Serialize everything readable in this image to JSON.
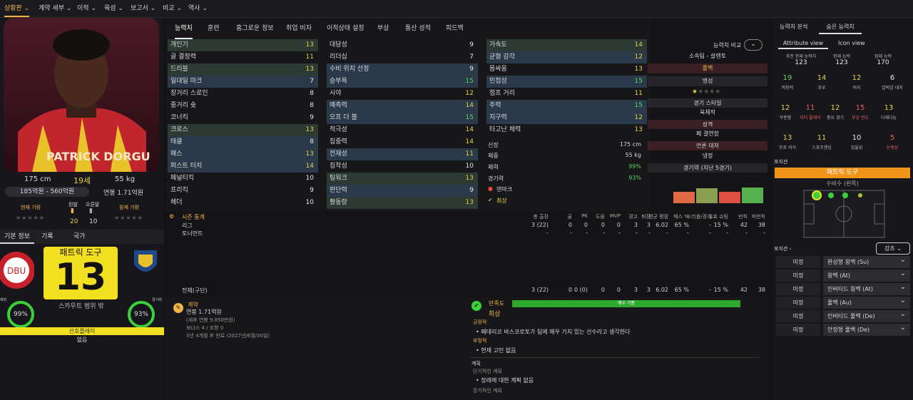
{
  "menu": [
    "상황판",
    "계약 세부",
    "이적",
    "육성",
    "보고서",
    "비교",
    "역사"
  ],
  "player": {
    "name": "PATRICK DORGU",
    "name_kr": "패트릭 도구",
    "number": "13",
    "height": "175 cm",
    "age": "19세",
    "weight": "55 kg",
    "value": "185억원 - 560억원",
    "wage": "연봉 1.71억원",
    "current_form": "현재 기량",
    "potential": "잠재 기량",
    "left_foot_label": "왼발",
    "right_foot_label": "오른발",
    "left_foot": "20",
    "right_foot": "10",
    "scout": "스카우트 범위 밖",
    "role_label": "선호플레이",
    "role_value": "없음",
    "pct_left": "99%",
    "pct_right": "93%",
    "pct_left_label": "체력",
    "pct_right_label": "경기력"
  },
  "left_tabs": [
    "기본 정보",
    "기록",
    "국가"
  ],
  "tabs": [
    "능력치",
    "훈련",
    "홈그로운 정보",
    "취업 비자",
    "이적상태 설정",
    "부상",
    "통산 성적",
    "피드백"
  ],
  "attributes_col1": [
    {
      "n": "개인기",
      "v": "13"
    },
    {
      "n": "골 결정력",
      "v": "11"
    },
    {
      "n": "드리블",
      "v": "13"
    },
    {
      "n": "일대일 마크",
      "v": "7"
    },
    {
      "n": "장거리 스로인",
      "v": "8"
    },
    {
      "n": "중거리 슛",
      "v": "8"
    },
    {
      "n": "코너킥",
      "v": "9"
    },
    {
      "n": "크로스",
      "v": "13"
    },
    {
      "n": "태클",
      "v": "8"
    },
    {
      "n": "패스",
      "v": "13"
    },
    {
      "n": "퍼스트 터치",
      "v": "14"
    },
    {
      "n": "페널티킥",
      "v": "10"
    },
    {
      "n": "프리킥",
      "v": "9"
    },
    {
      "n": "헤더",
      "v": "10"
    }
  ],
  "attributes_col2": [
    {
      "n": "대담성",
      "v": "9"
    },
    {
      "n": "리더십",
      "v": "7"
    },
    {
      "n": "수비 위치 선정",
      "v": "9"
    },
    {
      "n": "승부욕",
      "v": "15"
    },
    {
      "n": "시야",
      "v": "12"
    },
    {
      "n": "예측력",
      "v": "14"
    },
    {
      "n": "오프 더 볼",
      "v": "15"
    },
    {
      "n": "적극성",
      "v": "14"
    },
    {
      "n": "집중력",
      "v": "14"
    },
    {
      "n": "전재성",
      "v": "11"
    },
    {
      "n": "침착성",
      "v": "10"
    },
    {
      "n": "팀워크",
      "v": "13"
    },
    {
      "n": "판단력",
      "v": "9"
    },
    {
      "n": "활동량",
      "v": "13"
    }
  ],
  "attributes_col3": [
    {
      "n": "가속도",
      "v": "14"
    },
    {
      "n": "균형 감각",
      "v": "12"
    },
    {
      "n": "몸싸움",
      "v": "13"
    },
    {
      "n": "민첩성",
      "v": "15"
    },
    {
      "n": "점프 거리",
      "v": "11"
    },
    {
      "n": "주력",
      "v": "15"
    },
    {
      "n": "지구력",
      "v": "12"
    },
    {
      "n": "타고난 체력",
      "v": "13"
    }
  ],
  "physical": {
    "height_l": "신장",
    "height": "175 cm",
    "weight_l": "체중",
    "weight": "55 kg",
    "fitness_l": "체력",
    "fitness": "99%",
    "match_l": "경기력",
    "match": "93%",
    "nation": "덴마크",
    "best": "최상"
  },
  "compare": {
    "label": "능력치 비교",
    "team": "소속팀 - 살렌토",
    "team_value": "풀백",
    "reputation": "명성",
    "style_label": "경기 스타일",
    "style": "육체적",
    "personality_label": "성격",
    "personality": "페 결연함",
    "media_label": "언론 대처",
    "media": "냉정",
    "form_label": "경기력 (지난 5경기)"
  },
  "stats": {
    "title": "시즌 통계",
    "headers": [
      "총 출장",
      "골",
      "PK",
      "도움",
      "MVP",
      "경고",
      "퇴장",
      "평균 평점",
      "패스 %",
      "드리블/경기",
      "유효 슈팅",
      "반칙",
      "피반칙",
      "평점"
    ],
    "rows": [
      {
        "name": "리그",
        "vals": [
          "3 (22)",
          "0",
          "0",
          "0",
          "0",
          "3",
          "3",
          "6.02",
          "65 %",
          "-",
          "15 %",
          "42",
          "38",
          "6.30"
        ]
      },
      {
        "name": "토너먼트",
        "vals": [
          "-",
          "-",
          "-",
          "-",
          "-",
          "-",
          "-",
          "-",
          "-",
          "-",
          "-",
          "-",
          "-",
          "-"
        ]
      },
      {
        "name": "전체(구단)",
        "vals": [
          "3 (22)",
          "0",
          "0 (0)",
          "0",
          "0",
          "3",
          "3",
          "6.02",
          "65 %",
          "-",
          "15 %",
          "42",
          "38",
          "6.30"
        ]
      }
    ]
  },
  "contract": {
    "title": "계약",
    "wage": "연봉 1.71억원",
    "detail1": "(세후 연봉 9.850만원)",
    "detail2": "보너스 4 / 조항 0",
    "expiry": "3년 4개월 후 만료 (2027년/6월/30일)"
  },
  "happiness": {
    "title": "만족도",
    "level": "매우 기쁨",
    "status": "최상",
    "pos_label": "긍정적",
    "pos": "페데리코 바스코로토가 팀에 매우 가치 있는 선수라고 생각한다",
    "neg_label": "부정적",
    "neg": "현재 고민 없음",
    "plan_label": "계획",
    "short_label": "단기적인 계획",
    "short": "장래에 대한 계획 없음",
    "long_label": "장기적인 계획"
  },
  "right": {
    "tabs": [
      "능력치 분석",
      "숨은 능력치"
    ],
    "subtabs": [
      "Attribute view",
      "Icon view"
    ],
    "ability_labels": [
      "주전 현재 능력치",
      "현재 능력",
      "잠재 능력"
    ],
    "ability_vals": [
      "123",
      "123",
      "170"
    ],
    "hidden": [
      {
        "v": "19",
        "l": "적응력",
        "c": "#5ed35e"
      },
      {
        "v": "14",
        "l": "포부",
        "c": "#e6d04a"
      },
      {
        "v": "12",
        "l": "의리",
        "c": "#e6d04a"
      },
      {
        "v": "6",
        "l": "압박감 대처",
        "c": "#e8e8ec"
      },
      {
        "v": "12",
        "l": "꾸준함",
        "c": "#e6d04a"
      },
      {
        "v": "11",
        "l": "더티 플레이",
        "c": "#e86060"
      },
      {
        "v": "12",
        "l": "중요 경기",
        "c": "#e6d04a"
      },
      {
        "v": "15",
        "l": "부상 빈도",
        "c": "#e86060"
      },
      {
        "v": "13",
        "l": "다재다능",
        "c": "#e6d04a"
      },
      {
        "v": "13",
        "l": "프로 의식",
        "c": "#e6d04a"
      },
      {
        "v": "11",
        "l": "스포츠맨십",
        "c": "#e6d04a"
      },
      {
        "v": "10",
        "l": "침울성",
        "c": "#e8e8ec"
      },
      {
        "v": "5",
        "l": "논쟁성",
        "c": "#e86060"
      }
    ],
    "position_label": "포지션",
    "player_name": "패트릭 도구",
    "position": "수비수 (왼쪽)",
    "role_label": "포지션",
    "sort": "강조",
    "roles": [
      {
        "l": "미정",
        "r": "완성형 윙백 (Su)"
      },
      {
        "l": "미정",
        "r": "윙백 (At)"
      },
      {
        "l": "미정",
        "r": "인버티드 윙백 (At)"
      },
      {
        "l": "미정",
        "r": "풀백 (Au)"
      },
      {
        "l": "미정",
        "r": "인버티드 풀백 (De)"
      },
      {
        "l": "미정",
        "r": "안정형 풀백 (De)"
      }
    ]
  }
}
